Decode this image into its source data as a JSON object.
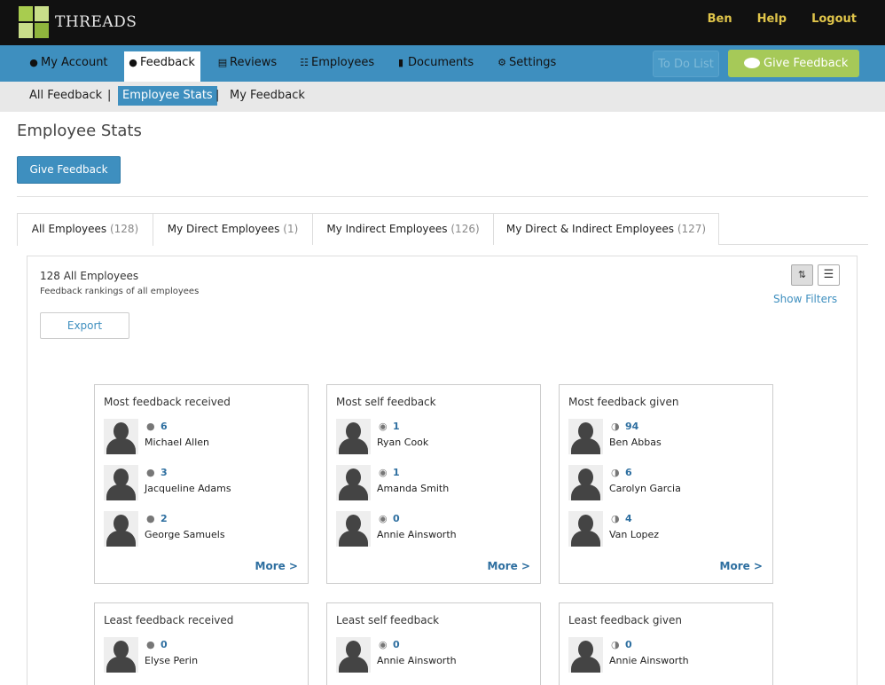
{
  "app": {
    "name": "THREADS"
  },
  "top_links": [
    "Ben",
    "Help",
    "Logout"
  ],
  "nav": {
    "items": [
      {
        "label": "My Account",
        "icon": "user-icon",
        "glyph": "☺"
      },
      {
        "label": "Feedback",
        "icon": "comment-icon",
        "glyph": "▬"
      },
      {
        "label": "Reviews",
        "icon": "document-icon",
        "glyph": "▤"
      },
      {
        "label": "Employees",
        "icon": "sitemap-icon",
        "glyph": "☰"
      },
      {
        "label": "Documents",
        "icon": "folder-icon",
        "glyph": "▮"
      },
      {
        "label": "Settings",
        "icon": "gear-icon",
        "glyph": "⚙"
      }
    ],
    "todo_label": "To Do List",
    "give_feedback_label": "Give Feedback"
  },
  "subnav": [
    "All Feedback",
    "Employee Stats",
    "My Feedback"
  ],
  "page": {
    "title": "Employee Stats",
    "give_feedback_label": "Give Feedback"
  },
  "tabs": [
    {
      "label": "All Employees",
      "count": "(128)"
    },
    {
      "label": "My Direct Employees",
      "count": "(1)"
    },
    {
      "label": "My Indirect Employees",
      "count": "(126)"
    },
    {
      "label": "My Direct & Indirect Employees",
      "count": "(127)"
    }
  ],
  "panel": {
    "title": "128 All Employees",
    "subtitle": "Feedback rankings of all employees",
    "export_label": "Export",
    "show_filters_label": "Show Filters",
    "more_label": "More >"
  },
  "cards": [
    {
      "title": "Most feedback received",
      "icon": "comment-icon",
      "entries": [
        {
          "value": "6",
          "name": "Michael Allen"
        },
        {
          "value": "3",
          "name": "Jacqueline Adams"
        },
        {
          "value": "2",
          "name": "George Samuels"
        }
      ]
    },
    {
      "title": "Most self feedback",
      "icon": "self-feedback-icon",
      "entries": [
        {
          "value": "1",
          "name": "Ryan Cook"
        },
        {
          "value": "1",
          "name": "Amanda Smith"
        },
        {
          "value": "0",
          "name": "Annie Ainsworth"
        }
      ]
    },
    {
      "title": "Most feedback given",
      "icon": "feedback-given-icon",
      "entries": [
        {
          "value": "94",
          "name": "Ben Abbas"
        },
        {
          "value": "6",
          "name": "Carolyn Garcia"
        },
        {
          "value": "4",
          "name": "Van Lopez"
        }
      ]
    },
    {
      "title": "Least feedback received",
      "icon": "comment-icon",
      "entries": [
        {
          "value": "0",
          "name": "Elyse Perin"
        }
      ]
    },
    {
      "title": "Least self feedback",
      "icon": "self-feedback-icon",
      "entries": [
        {
          "value": "0",
          "name": "Annie Ainsworth"
        }
      ]
    },
    {
      "title": "Least feedback given",
      "icon": "feedback-given-icon",
      "entries": [
        {
          "value": "0",
          "name": "Annie Ainsworth"
        }
      ]
    }
  ]
}
